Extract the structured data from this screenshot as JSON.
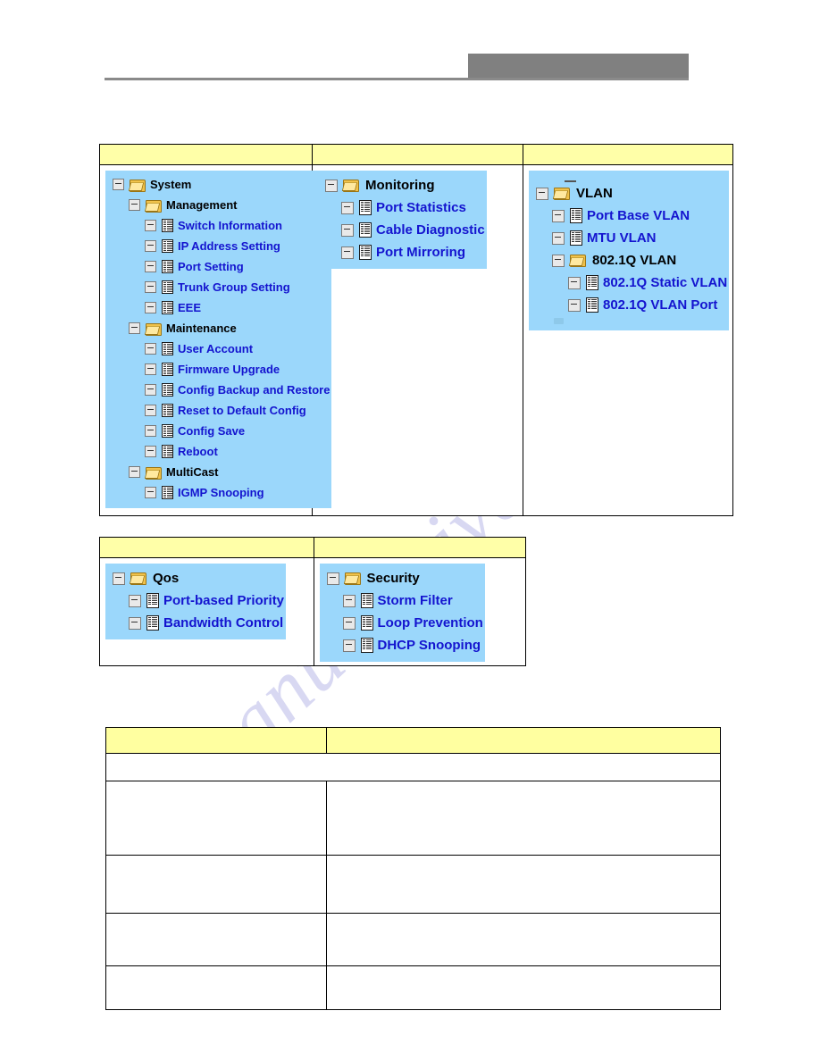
{
  "header": {
    "redacted_block": "",
    "rule": ""
  },
  "watermark": {
    "text": "manualshive.com"
  },
  "colors": {
    "panel_background": "#9bd7fb",
    "header_row": "#ffffa8",
    "leaf_link": "#1414cf",
    "folder_label": "#000000",
    "redacted_block": "#808080",
    "watermark": "#b9b9e8"
  },
  "tree_tables": {
    "top": {
      "columns": [
        {
          "header": "",
          "panel": {
            "name": "system-tree",
            "size": "normal",
            "nodes": [
              {
                "level": 0,
                "type": "folder",
                "label": "System"
              },
              {
                "level": 1,
                "type": "folder",
                "label": "Management"
              },
              {
                "level": 2,
                "type": "doc",
                "label": "Switch Information"
              },
              {
                "level": 2,
                "type": "doc",
                "label": "IP Address Setting"
              },
              {
                "level": 2,
                "type": "doc",
                "label": "Port Setting"
              },
              {
                "level": 2,
                "type": "doc",
                "label": "Trunk Group Setting"
              },
              {
                "level": 2,
                "type": "doc",
                "label": "EEE"
              },
              {
                "level": 1,
                "type": "folder",
                "label": "Maintenance"
              },
              {
                "level": 2,
                "type": "doc",
                "label": "User Account"
              },
              {
                "level": 2,
                "type": "doc",
                "label": "Firmware Upgrade"
              },
              {
                "level": 2,
                "type": "doc",
                "label": "Config Backup and Restore"
              },
              {
                "level": 2,
                "type": "doc",
                "label": "Reset to Default Config"
              },
              {
                "level": 2,
                "type": "doc",
                "label": "Config Save"
              },
              {
                "level": 2,
                "type": "doc",
                "label": "Reboot"
              },
              {
                "level": 1,
                "type": "folder",
                "label": "MultiCast"
              },
              {
                "level": 2,
                "type": "doc",
                "label": "IGMP Snooping"
              }
            ]
          }
        },
        {
          "header": "",
          "panel": {
            "name": "monitoring-tree",
            "size": "big",
            "nodes": [
              {
                "level": 0,
                "type": "folder",
                "label": "Monitoring"
              },
              {
                "level": 1,
                "type": "doc",
                "label": "Port Statistics"
              },
              {
                "level": 1,
                "type": "doc",
                "label": "Cable Diagnostic"
              },
              {
                "level": 1,
                "type": "doc",
                "label": "Port Mirroring"
              }
            ]
          }
        },
        {
          "header": "",
          "panel": {
            "name": "vlan-tree",
            "size": "big",
            "stub_top": true,
            "stub_bottom": true,
            "nodes": [
              {
                "level": 0,
                "type": "folder",
                "label": "VLAN"
              },
              {
                "level": 1,
                "type": "doc",
                "label": "Port Base VLAN"
              },
              {
                "level": 1,
                "type": "doc",
                "label": "MTU VLAN"
              },
              {
                "level": 1,
                "type": "folder",
                "label": "802.1Q VLAN"
              },
              {
                "level": 2,
                "type": "doc",
                "label": "802.1Q Static VLAN"
              },
              {
                "level": 2,
                "type": "doc",
                "label": "802.1Q VLAN Port"
              }
            ]
          }
        }
      ]
    },
    "bottom": {
      "columns": [
        {
          "header": "",
          "panel": {
            "name": "qos-tree",
            "size": "big",
            "nodes": [
              {
                "level": 0,
                "type": "folder",
                "label": "Qos"
              },
              {
                "level": 1,
                "type": "doc",
                "label": "Port-based Priority"
              },
              {
                "level": 1,
                "type": "doc",
                "label": "Bandwidth Control"
              }
            ]
          }
        },
        {
          "header": "",
          "panel": {
            "name": "security-tree",
            "size": "big",
            "nodes": [
              {
                "level": 0,
                "type": "folder",
                "label": "Security"
              },
              {
                "level": 1,
                "type": "doc",
                "label": "Storm Filter"
              },
              {
                "level": 1,
                "type": "doc",
                "label": "Loop Prevention"
              },
              {
                "level": 1,
                "type": "doc",
                "label": "DHCP Snooping"
              }
            ]
          }
        }
      ]
    }
  },
  "description_table": {
    "headers": [
      "",
      ""
    ],
    "rows": [
      {
        "cells": [
          "",
          ""
        ],
        "span": true,
        "height": 24
      },
      {
        "cells": [
          "",
          ""
        ],
        "height": 76
      },
      {
        "cells": [
          "",
          ""
        ],
        "height": 58
      },
      {
        "cells": [
          "",
          ""
        ],
        "height": 52
      },
      {
        "cells": [
          "",
          ""
        ],
        "height": 42
      }
    ]
  }
}
